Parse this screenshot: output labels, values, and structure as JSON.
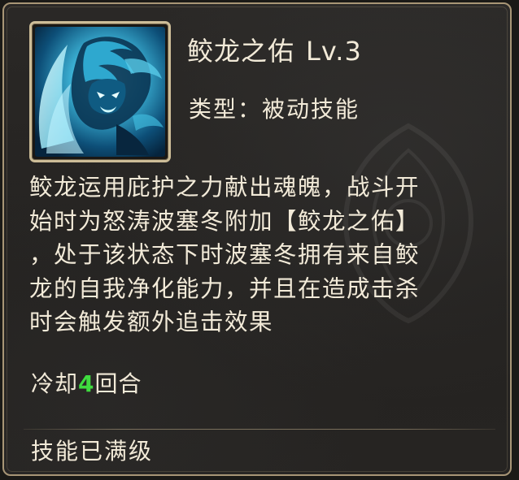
{
  "skill": {
    "name": "鲛龙之佑",
    "level": "Lv.3",
    "type_label": "类型：",
    "type_value": "被动技能",
    "icon": "sea-dragon-icon",
    "description_lines": [
      "鲛龙运用庇护之力献出魂魄，战斗开",
      "始时为怒涛波塞冬附加【鲛龙之佑】",
      "，处于该状态下时波塞冬拥有来自鲛",
      "龙的自我净化能力，并且在造成击杀",
      "时会触发额外追击效果"
    ],
    "cooldown_prefix": "冷却",
    "cooldown_value": "4",
    "cooldown_suffix": "回合",
    "max_level_text": "技能已满级"
  },
  "colors": {
    "text": "#f2ead8",
    "cooldown_number": "#3fdc3f",
    "border": "#a89676",
    "background": "#262422"
  }
}
